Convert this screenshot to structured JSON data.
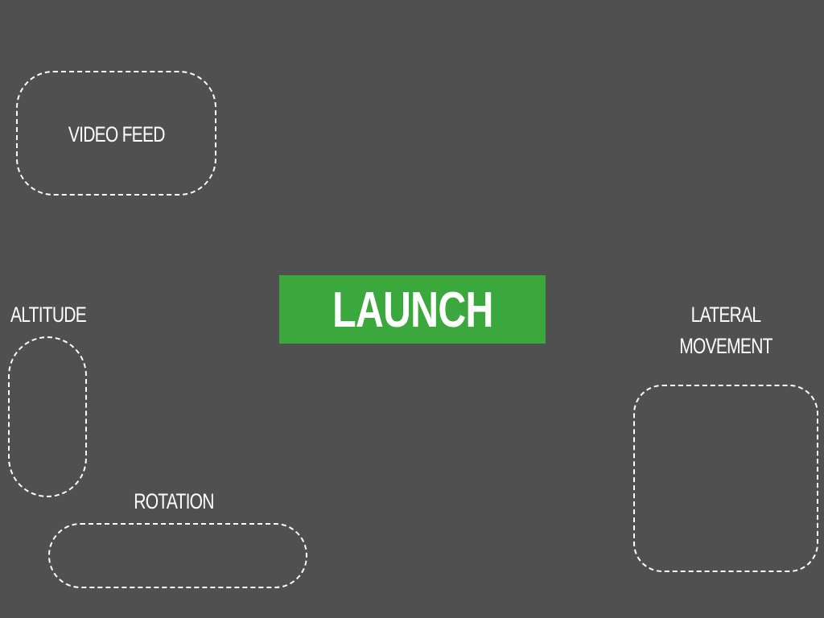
{
  "colors": {
    "background": "#505050",
    "launch_button": "#3aa83c",
    "zone_border": "#ffffff",
    "text": "#ffffff"
  },
  "launch": {
    "label": "LAUNCH"
  },
  "video_feed": {
    "label": "VIDEO FEED"
  },
  "altitude": {
    "label": "ALTITUDE"
  },
  "rotation": {
    "label": "ROTATION"
  },
  "lateral_movement": {
    "label_line1": "LATERAL",
    "label_line2": "MOVEMENT"
  }
}
